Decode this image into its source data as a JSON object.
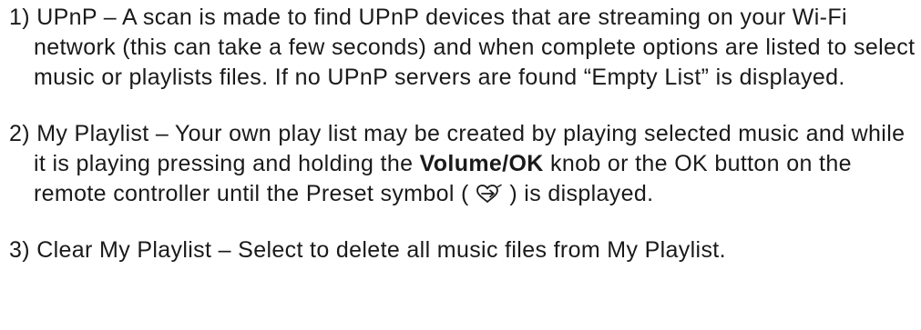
{
  "items": [
    {
      "number": "1)",
      "text": "UPnP – A scan is made to find UPnP devices that are streaming on your Wi-Fi network (this can take a few seconds) and when complete options are listed to select music or playlists files. If no UPnP servers are found “Empty List” is displayed."
    },
    {
      "number": "2)",
      "text_before_bold": "My Playlist – Your own play list may be created by playing selected music and while it is playing pressing and holding the",
      "bold": "Volume/OK",
      "text_after_bold": "knob or the OK button on the remote controller until the Preset symbol (",
      "icon": "preset-heart-icon",
      "text_end": ") is displayed."
    },
    {
      "number": "3)",
      "text": "Clear My Playlist – Select to delete all music files from My Playlist."
    }
  ]
}
